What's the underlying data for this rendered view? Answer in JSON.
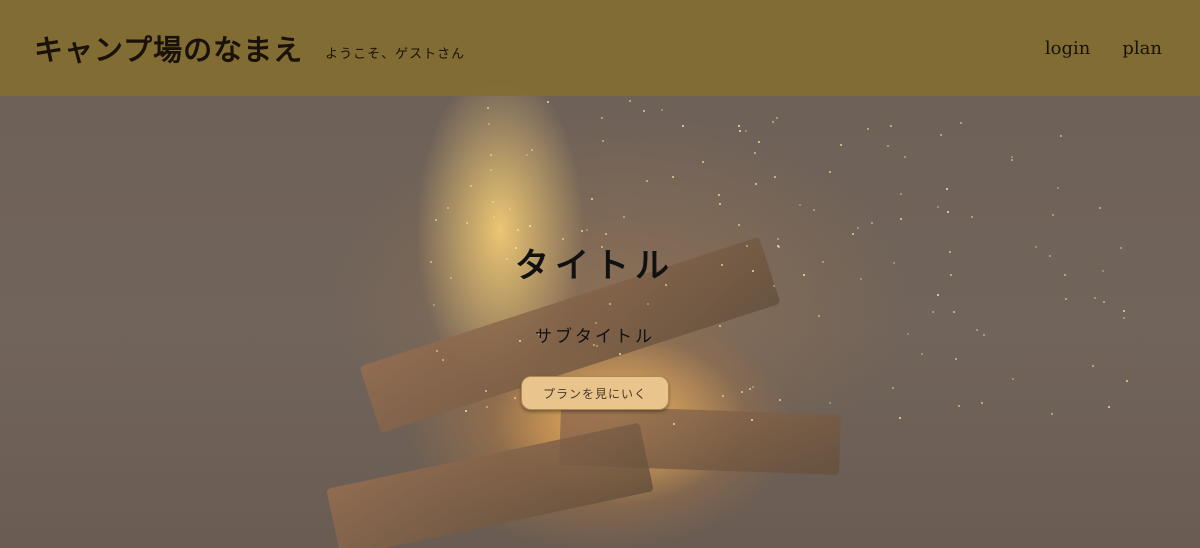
{
  "header": {
    "site_title": "キャンプ場のなまえ",
    "welcome": "ようこそ、ゲストさん",
    "nav": [
      {
        "label": "login"
      },
      {
        "label": "plan"
      }
    ],
    "background_color": "#83703a"
  },
  "hero": {
    "title": "タイトル",
    "subtitle": "サブタイトル",
    "button_label": "プランを見にいく",
    "button_color": "#e9c48d",
    "background_image": "campfire-photo"
  }
}
